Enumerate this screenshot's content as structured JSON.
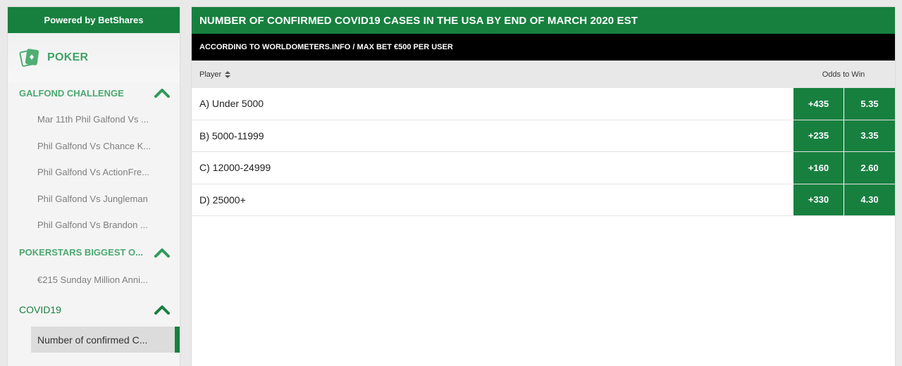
{
  "sidebar": {
    "header": "Powered by BetShares",
    "section": "POKER",
    "categories": [
      {
        "label": "GALFOND CHALLENGE",
        "items": [
          "Mar 11th Phil Galfond Vs ...",
          "Phil Galfond Vs Chance K...",
          "Phil Galfond Vs ActionFre...",
          "Phil Galfond Vs Jungleman",
          "Phil Galfond Vs Brandon ..."
        ]
      },
      {
        "label": "POKERSTARS BIGGEST O...",
        "items": [
          "€215 Sunday Million Anni..."
        ]
      },
      {
        "label": "COVID19",
        "items": [
          "Number of confirmed C..."
        ]
      }
    ]
  },
  "main": {
    "title": "NUMBER OF CONFIRMED COVID19 CASES IN THE USA BY END OF MARCH 2020 EST",
    "subtitle": "ACCORDING TO WORLDOMETERS.INFO / MAX BET €500 PER USER",
    "columns": {
      "player": "Player",
      "odds": "Odds to Win"
    },
    "rows": [
      {
        "label": "A) Under 5000",
        "american": "+435",
        "decimal": "5.35"
      },
      {
        "label": "B) 5000-11999",
        "american": "+235",
        "decimal": "3.35"
      },
      {
        "label": "C) 12000-24999",
        "american": "+160",
        "decimal": "2.60"
      },
      {
        "label": "D) 25000+",
        "american": "+330",
        "decimal": "4.30"
      }
    ]
  },
  "colors": {
    "brand_green": "#17803f",
    "black_bar": "#000000",
    "header_gray": "#e8e8e8"
  },
  "icons": {
    "poker": "playing-cards-icon",
    "collapse": "chevron-up-icon",
    "sort": "sort-icon"
  }
}
